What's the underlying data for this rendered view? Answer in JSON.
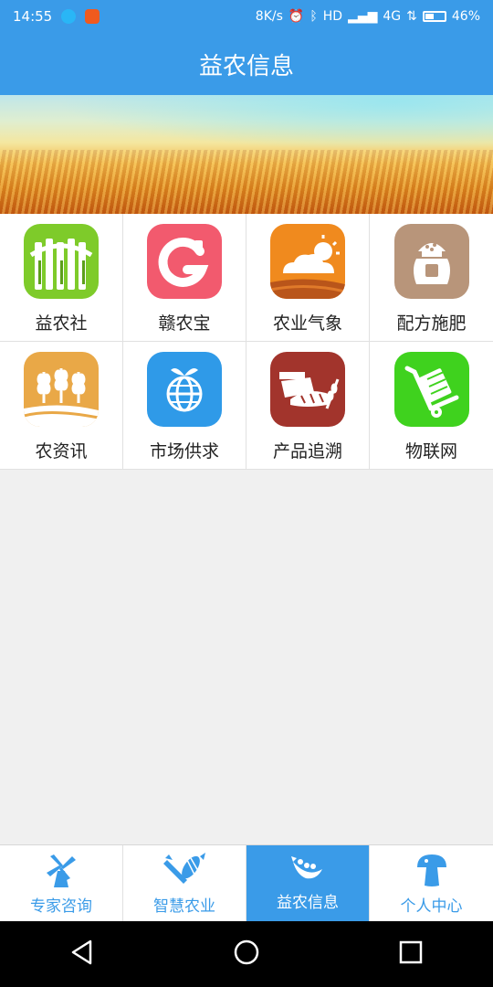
{
  "status": {
    "time": "14:55",
    "net_speed": "8K/s",
    "hd": "HD",
    "network": "4G",
    "battery": "46%"
  },
  "app_title": "益农信息",
  "colors": {
    "primary": "#3a9be8"
  },
  "grid": [
    {
      "label": "益农社",
      "icon": "fence-icon",
      "bg": "#7ecb2a"
    },
    {
      "label": "赣农宝",
      "icon": "g-logo-icon",
      "bg": "#f25a6e"
    },
    {
      "label": "农业气象",
      "icon": "weather-icon",
      "bg": "#f08a1e"
    },
    {
      "label": "配方施肥",
      "icon": "fertilizer-bag-icon",
      "bg": "#b8957a"
    },
    {
      "label": "农资讯",
      "icon": "wheat-icon",
      "bg": "#e9a847"
    },
    {
      "label": "市场供求",
      "icon": "globe-fruit-icon",
      "bg": "#2f9ae8"
    },
    {
      "label": "产品追溯",
      "icon": "bread-icon",
      "bg": "#a2342c"
    },
    {
      "label": "物联网",
      "icon": "hand-truck-icon",
      "bg": "#3fd21e"
    }
  ],
  "tabs": [
    {
      "label": "专家咨询",
      "icon": "windmill-icon"
    },
    {
      "label": "智慧农业",
      "icon": "vegetables-icon"
    },
    {
      "label": "益农信息",
      "icon": "peapod-icon",
      "active": true
    },
    {
      "label": "个人中心",
      "icon": "mushroom-icon"
    }
  ],
  "nav": [
    "back-icon",
    "home-icon",
    "recents-icon"
  ]
}
